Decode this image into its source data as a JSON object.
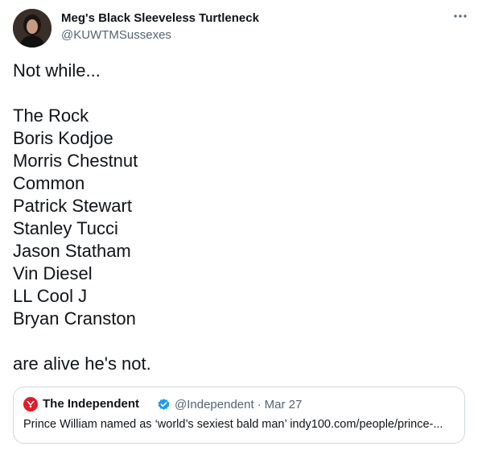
{
  "author": {
    "display_name": "Meg's Black Sleeveless Turtleneck",
    "handle": "@KUWTMSussexes",
    "avatar_icon": "profile-photo"
  },
  "tweet": {
    "intro": "Not while...",
    "names": [
      "The Rock",
      "Boris Kodjoe",
      "Morris Chestnut",
      "Common",
      "Patrick Stewart",
      "Stanley Tucci",
      "Jason Statham",
      "Vin Diesel",
      "LL Cool J",
      "Bryan Cranston"
    ],
    "outro": "are alive he's not."
  },
  "quoted": {
    "name": "The Independent",
    "handle": "@Independent",
    "separator": "·",
    "date": "Mar 27",
    "text": "Prince William named as ‘world’s sexiest bald man’ indy100.com/people/prince-...",
    "logo_icon": "independent-eagle-logo",
    "verified_icon": "verified-badge-icon"
  },
  "colors": {
    "text": "#0f1419",
    "secondary": "#536471",
    "border": "#cfd9de",
    "verified": "#1d9bf0",
    "independent_red": "#e11c28"
  }
}
